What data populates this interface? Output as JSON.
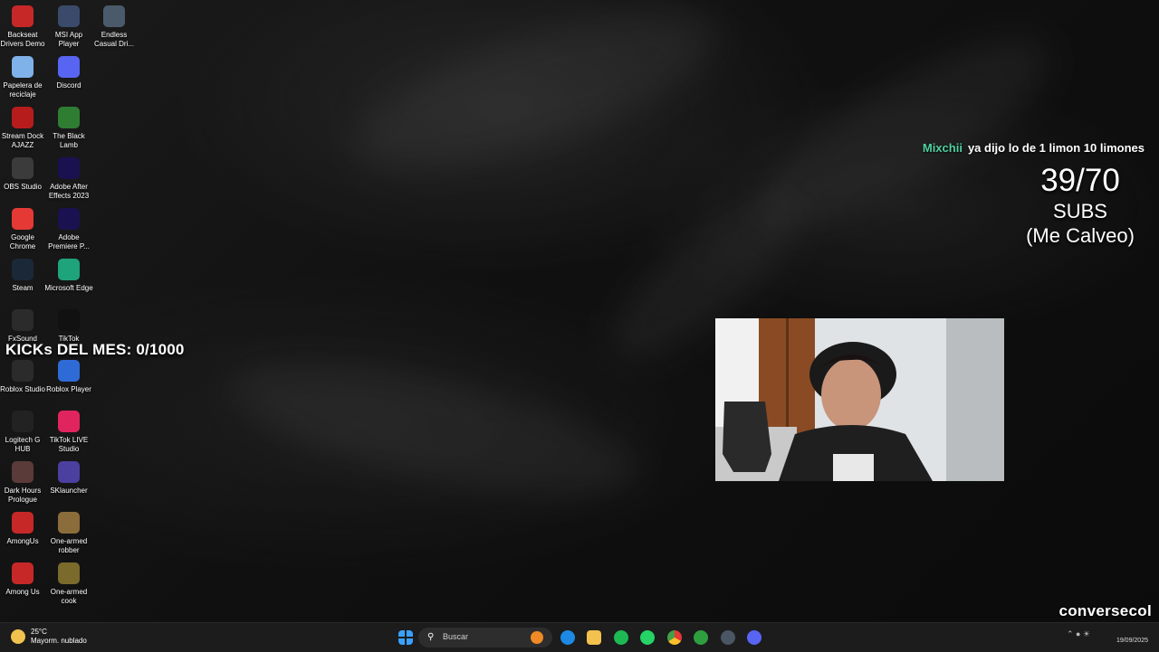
{
  "desktop_icons": [
    {
      "label": "Backseat Drivers Demo",
      "icon": "car-game-icon",
      "color": "#c62828"
    },
    {
      "label": "MSI App Player",
      "icon": "msi-app-player-icon",
      "color": "#3a4a6b"
    },
    {
      "label": "Endless Casual Dri...",
      "icon": "endless-casual-driving-icon",
      "color": "#4a5a6a"
    },
    {
      "label": "Papelera de reciclaje",
      "icon": "recycle-bin-icon",
      "color": "#7fb2e8"
    },
    {
      "label": "Discord",
      "icon": "discord-icon",
      "color": "#5865f2"
    },
    {
      "label": "Stream Dock AJAZZ",
      "icon": "stream-dock-icon",
      "color": "#b71c1c"
    },
    {
      "label": "The Black Lamb",
      "icon": "black-lamb-icon",
      "color": "#2e7d32"
    },
    {
      "label": "OBS Studio",
      "icon": "obs-icon",
      "color": "#3b3b3b"
    },
    {
      "label": "Adobe After Effects 2023",
      "icon": "after-effects-icon",
      "color": "#1a1250"
    },
    {
      "label": "Google Chrome",
      "icon": "chrome-icon",
      "color": "#e53935"
    },
    {
      "label": "Adobe Premiere P...",
      "icon": "premiere-icon",
      "color": "#1a1250"
    },
    {
      "label": "Steam",
      "icon": "steam-icon",
      "color": "#1b2838"
    },
    {
      "label": "Microsoft Edge",
      "icon": "edge-icon",
      "color": "#1fa37a"
    },
    {
      "label": "FxSound",
      "icon": "fxsound-icon",
      "color": "#2b2b2b"
    },
    {
      "label": "TikTok",
      "icon": "tiktok-icon",
      "color": "#111111"
    },
    {
      "label": "Roblox Studio",
      "icon": "roblox-studio-icon",
      "color": "#2b2b2b"
    },
    {
      "label": "Roblox Player",
      "icon": "roblox-player-icon",
      "color": "#2f6bd6"
    },
    {
      "label": "Logitech G HUB",
      "icon": "logitech-icon",
      "color": "#222222"
    },
    {
      "label": "TikTok LIVE Studio",
      "icon": "tiktok-live-icon",
      "color": "#e0245e"
    },
    {
      "label": "Dark Hours Prologue",
      "icon": "dark-hours-icon",
      "color": "#5b3a3a"
    },
    {
      "label": "SKlauncher",
      "icon": "sklauncher-icon",
      "color": "#4b3fa0"
    },
    {
      "label": "AmongUs",
      "icon": "among-us-icon",
      "color": "#c62828"
    },
    {
      "label": "One-armed robber",
      "icon": "one-armed-robber-icon",
      "color": "#8a6d3b"
    },
    {
      "label": "Among Us",
      "icon": "among-us-icon",
      "color": "#c62828"
    },
    {
      "label": "One-armed cook",
      "icon": "one-armed-cook-icon",
      "color": "#7a6a2b"
    }
  ],
  "overlay": {
    "kicks": "KICKs DEL MES: 0/1000",
    "chat_user": "Mixchii",
    "chat_message": "ya dijo lo de 1 limon 10 limones",
    "subs_count": "39/70",
    "subs_word": "SUBS",
    "subs_note": "(Me Calveo)",
    "brand": "conversecol"
  },
  "taskbar": {
    "weather_temp": "25°C",
    "weather_desc": "Mayorm. nublado",
    "search_placeholder": "Buscar",
    "date": "19/09/2025"
  }
}
